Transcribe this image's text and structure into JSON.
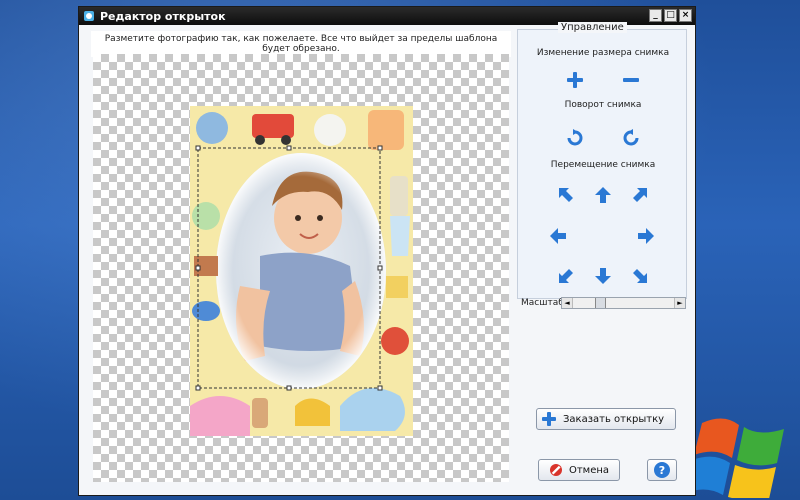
{
  "window": {
    "title": "Редактор открыток",
    "controls": {
      "minimize": "_",
      "maximize": "□",
      "close": "×"
    }
  },
  "editor": {
    "hint": "Разметите фотографию так, как пожелаете. Все что выйдет за пределы шаблона будет обрезано."
  },
  "sidebar": {
    "legend": "Управление",
    "resize_label": "Изменение размера снимка",
    "rotate_label": "Поворот снимка",
    "move_label": "Перемещение снимка",
    "scale_label": "Масштаб",
    "scale_value": 0.25
  },
  "buttons": {
    "order": "Заказать открытку",
    "cancel": "Отмена",
    "help": "?"
  },
  "colors": {
    "accent_blue": "#2a78d4",
    "frame_yellow": "#f6e9a8",
    "titlebar": "#111111"
  }
}
